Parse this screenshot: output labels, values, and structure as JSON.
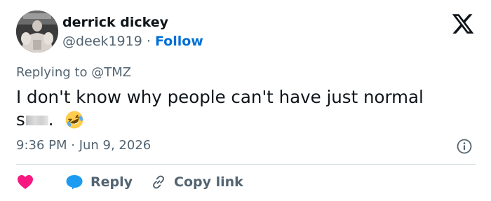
{
  "author": {
    "name": "derrick dickey",
    "handle": "@deek1919",
    "separator": "·",
    "follow_label": "Follow"
  },
  "replying": {
    "prefix": "Replying to",
    "handle": "@TMZ"
  },
  "tweet": {
    "text_main": "I don't know why people can't have just normal",
    "text_censored_start": "s",
    "text_end": ".",
    "emoji": "rolling-on-the-floor-laughing"
  },
  "meta": {
    "timestamp": "9:36 PM · Jun 9, 2026"
  },
  "actions": {
    "reply_label": "Reply",
    "copy_link_label": "Copy link"
  },
  "colors": {
    "text": "#0f1419",
    "secondary": "#536471",
    "link": "#006fd6",
    "heart": "#f91880",
    "reply_bubble": "#1d9bf0",
    "divider": "#cfd9de"
  },
  "icons": [
    "x-logo-icon",
    "info-icon",
    "heart-icon",
    "reply-bubble-icon",
    "link-icon",
    "laughing-emoji-icon"
  ]
}
